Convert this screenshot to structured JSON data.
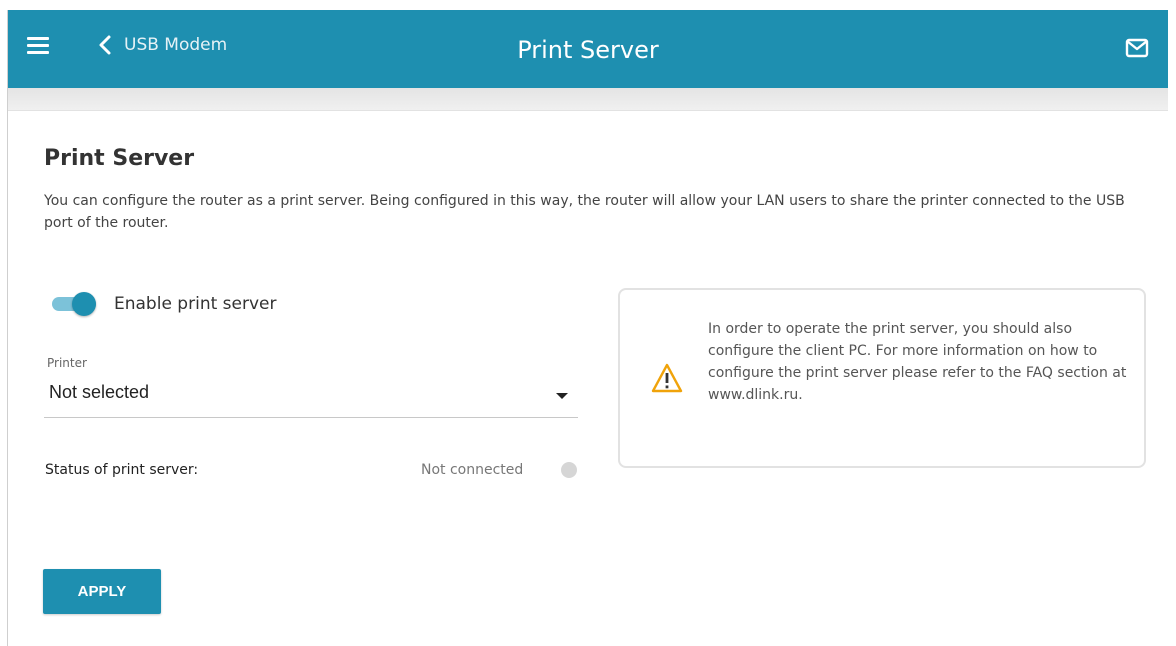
{
  "header": {
    "back_label": "USB Modem",
    "title": "Print Server",
    "icons": {
      "menu": "hamburger-icon",
      "back": "chevron-left-icon",
      "messages": "mail-icon"
    },
    "color": "#1e8fb0"
  },
  "main": {
    "section_title": "Print Server",
    "description": "You can configure the router as a print server. Being configured in this way, the router will allow your LAN users to share the printer connected to the USB port of the router.",
    "enable_toggle": {
      "label": "Enable print server",
      "on": true
    },
    "printer": {
      "label": "Printer",
      "selected": "Not selected"
    },
    "status": {
      "label": "Status of print server:",
      "value": "Not connected",
      "indicator_color": "#d6d6d6"
    },
    "info": {
      "icon": "warning-icon",
      "text": "In order to operate the print server, you should also configure the client PC. For more information on how to configure the print server please refer to the FAQ section at www.dlink.ru."
    },
    "apply_label": "APPLY"
  }
}
